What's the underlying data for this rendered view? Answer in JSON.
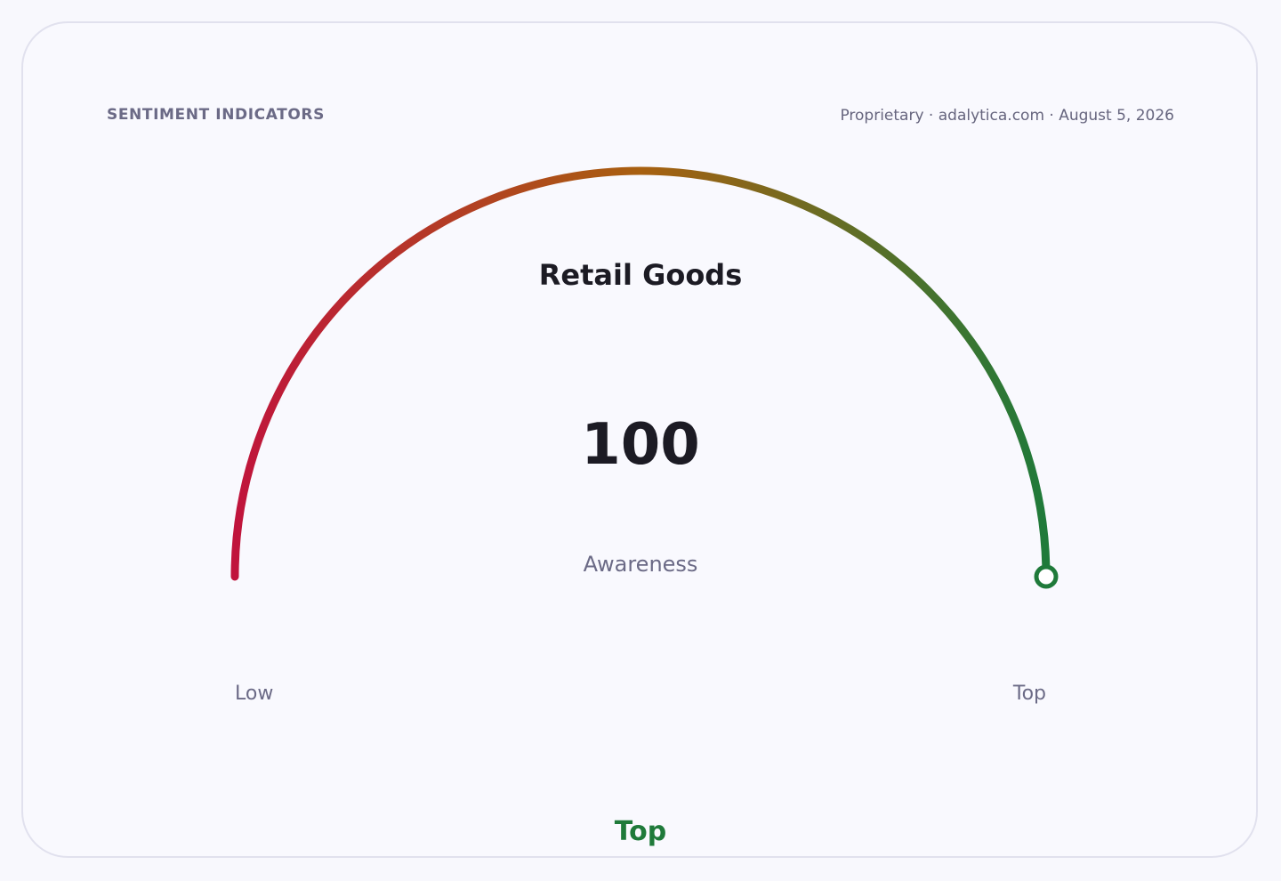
{
  "header": {
    "eyebrow": "SENTIMENT INDICATORS",
    "source": "Proprietary · adalytica.com · August 5, 2026"
  },
  "chart_data": {
    "type": "gauge",
    "title": "Retail Goods",
    "value": 100,
    "value_label": "100",
    "metric": "Awareness",
    "min_label": "Low",
    "max_label": "Top",
    "range": [
      0,
      100
    ],
    "band_label": "Top",
    "colors": {
      "low": "#c0143c",
      "mid": "#a86010",
      "high": "#1f7a3a",
      "band": "#1f7a3a"
    }
  }
}
